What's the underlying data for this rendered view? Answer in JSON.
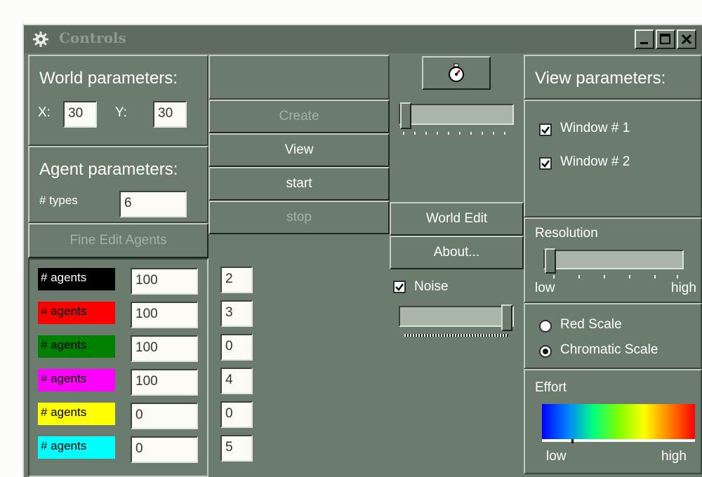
{
  "window": {
    "title": "Controls"
  },
  "world": {
    "heading": "World parameters:",
    "x_label": "X:",
    "x_value": "30",
    "y_label": "Y:",
    "y_value": "30"
  },
  "agent": {
    "heading": "Agent parameters:",
    "types_label": "# types",
    "types_value": "6",
    "fine_edit_label": "Fine Edit Agents"
  },
  "agents": [
    {
      "label": "# agents",
      "count": "100",
      "value": "2",
      "color": "#000000",
      "text_color": "#ffffff"
    },
    {
      "label": "# agents",
      "count": "100",
      "value": "3",
      "color": "#ff0000",
      "text_color": "#000000"
    },
    {
      "label": "# agents",
      "count": "100",
      "value": "0",
      "color": "#008000",
      "text_color": "#000000"
    },
    {
      "label": "# agents",
      "count": "100",
      "value": "4",
      "color": "#ff00ff",
      "text_color": "#000000"
    },
    {
      "label": "# agents",
      "count": "0",
      "value": "0",
      "color": "#ffff00",
      "text_color": "#000000"
    },
    {
      "label": "# agents",
      "count": "0",
      "value": "5",
      "color": "#00ffff",
      "text_color": "#000000"
    }
  ],
  "buttons": {
    "create": "Create",
    "view": "View",
    "start": "start",
    "stop": "stop",
    "world_edit": "World Edit",
    "about": "About..."
  },
  "icons": {
    "app": "gear-icon",
    "timer": "stopwatch-icon"
  },
  "noise": {
    "label": "Noise",
    "checked": true,
    "level": 1.0
  },
  "speed": {
    "level": 0.0
  },
  "view": {
    "heading": "View parameters:",
    "window1_label": "Window # 1",
    "window1_checked": true,
    "window2_label": "Window # 2",
    "window2_checked": true
  },
  "resolution": {
    "heading": "Resolution",
    "low": "low",
    "high": "high",
    "level": 0.0
  },
  "scale": {
    "red_label": "Red Scale",
    "chromatic_label": "Chromatic Scale",
    "selected": "Chromatic Scale"
  },
  "effort": {
    "heading": "Effort",
    "low": "low",
    "high": "high",
    "gradient": [
      "#0000ff",
      "#0080ff",
      "#00ff80",
      "#80ff00",
      "#ffff00",
      "#ff8000",
      "#ff0000"
    ]
  }
}
